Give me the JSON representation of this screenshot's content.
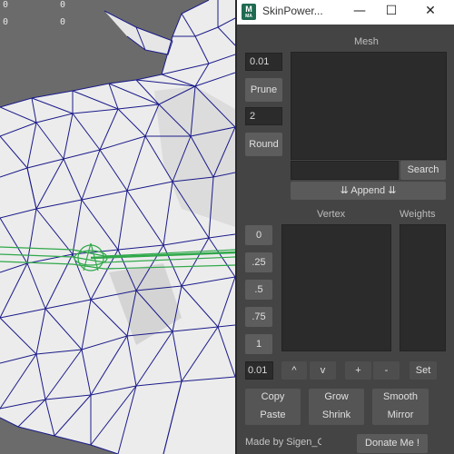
{
  "viewport": {
    "hud_left_top": "0",
    "hud_left_bottom": "0",
    "hud_right_top": "0",
    "hud_right_bottom": "0"
  },
  "window": {
    "icon_letter": "M",
    "icon_sub": "MA",
    "title": "SkinPower...",
    "minimize": "—",
    "maximize": "☐",
    "close": "✕"
  },
  "mesh": {
    "header": "Mesh",
    "prune_value": "0.01",
    "prune_label": "Prune",
    "round_value": "2",
    "round_label": "Round",
    "search_value": "",
    "search_label": "Search",
    "append_label": "⇊ Append ⇊"
  },
  "vertex": {
    "header": "Vertex",
    "weights_header": "Weights",
    "presets": [
      "0",
      ".25",
      ".5",
      ".75",
      "1"
    ],
    "step_value": "0.01",
    "up_label": "^",
    "down_label": "v",
    "plus_label": "+",
    "minus_label": "-",
    "set_label": "Set"
  },
  "actions": {
    "copy": "Copy",
    "paste": "Paste",
    "grow": "Grow",
    "shrink": "Shrink",
    "smooth": "Smooth",
    "mirror": "Mirror"
  },
  "footer": {
    "credit": "Made by Sigen_Chang",
    "donate": "Donate Me !"
  }
}
